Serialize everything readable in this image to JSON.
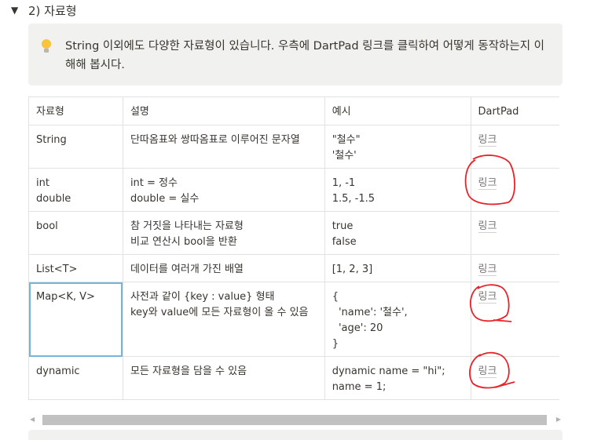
{
  "toggle": {
    "arrow": "▼",
    "title": "2) 자료형"
  },
  "callout": {
    "icon": "lightbulb-icon",
    "text": "String 이외에도 다양한 자료형이 있습니다. 우측에 DartPad 링크를 클릭하여 어떻게 동작하는지 이해해 봅시다."
  },
  "table": {
    "headers": [
      "자료형",
      "설명",
      "예시",
      "DartPad"
    ],
    "rows": [
      {
        "type": [
          "String"
        ],
        "desc": [
          "단따옴표와 쌍따옴표로 이루어진 문자열"
        ],
        "example": [
          "\"철수\"",
          "'철수'"
        ],
        "link": "링크"
      },
      {
        "type": [
          "int",
          "double"
        ],
        "desc": [
          "int = 정수",
          "double = 실수"
        ],
        "example": [
          "1, -1",
          "1.5, -1.5"
        ],
        "link": "링크"
      },
      {
        "type": [
          "bool"
        ],
        "desc": [
          "참 거짓을 나타내는 자료형",
          "비교 연산시 bool을 반환"
        ],
        "example": [
          "true",
          "false"
        ],
        "link": "링크"
      },
      {
        "type": [
          "List<T>"
        ],
        "desc": [
          "데이터를 여러개 가진 배열"
        ],
        "example": [
          "[1, 2, 3]"
        ],
        "link": "링크"
      },
      {
        "type": [
          "Map<K, V>"
        ],
        "desc": [
          "사전과 같이 {key : value} 형태",
          "key와 value에 모든 자료형이 올 수 있음"
        ],
        "example": [
          "{",
          "  'name': '철수',",
          "  'age': 20",
          "}"
        ],
        "link": "링크"
      },
      {
        "type": [
          "dynamic"
        ],
        "desc": [
          "모든 자료형을 담을 수 있음"
        ],
        "example": [
          "dynamic name = \"hi\";",
          "name = 1;"
        ],
        "link": "링크"
      }
    ]
  },
  "scrollbar": {
    "left_arrow": "◀",
    "right_arrow": "▶"
  },
  "colors": {
    "annotation": "#e8232a",
    "selection": "#74b6db",
    "callout_bg": "#f1f1ef"
  }
}
